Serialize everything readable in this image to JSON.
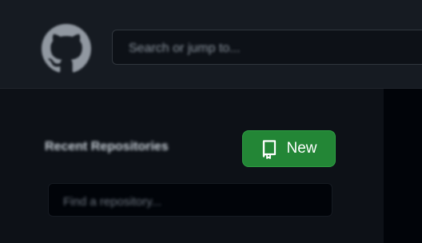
{
  "header": {
    "logo_icon": "github-octocat-icon",
    "search_placeholder": "Search or jump to..."
  },
  "sidebar": {
    "recent_title": "Recent Repositories",
    "new_button": {
      "icon": "repo-icon",
      "label": "New"
    },
    "find_placeholder": "Find a repository..."
  },
  "colors": {
    "background": "#0d1117",
    "header_bg": "#161b22",
    "new_button_bg": "#238636",
    "text_primary": "#c9d1d9",
    "text_muted": "#8b949e"
  }
}
